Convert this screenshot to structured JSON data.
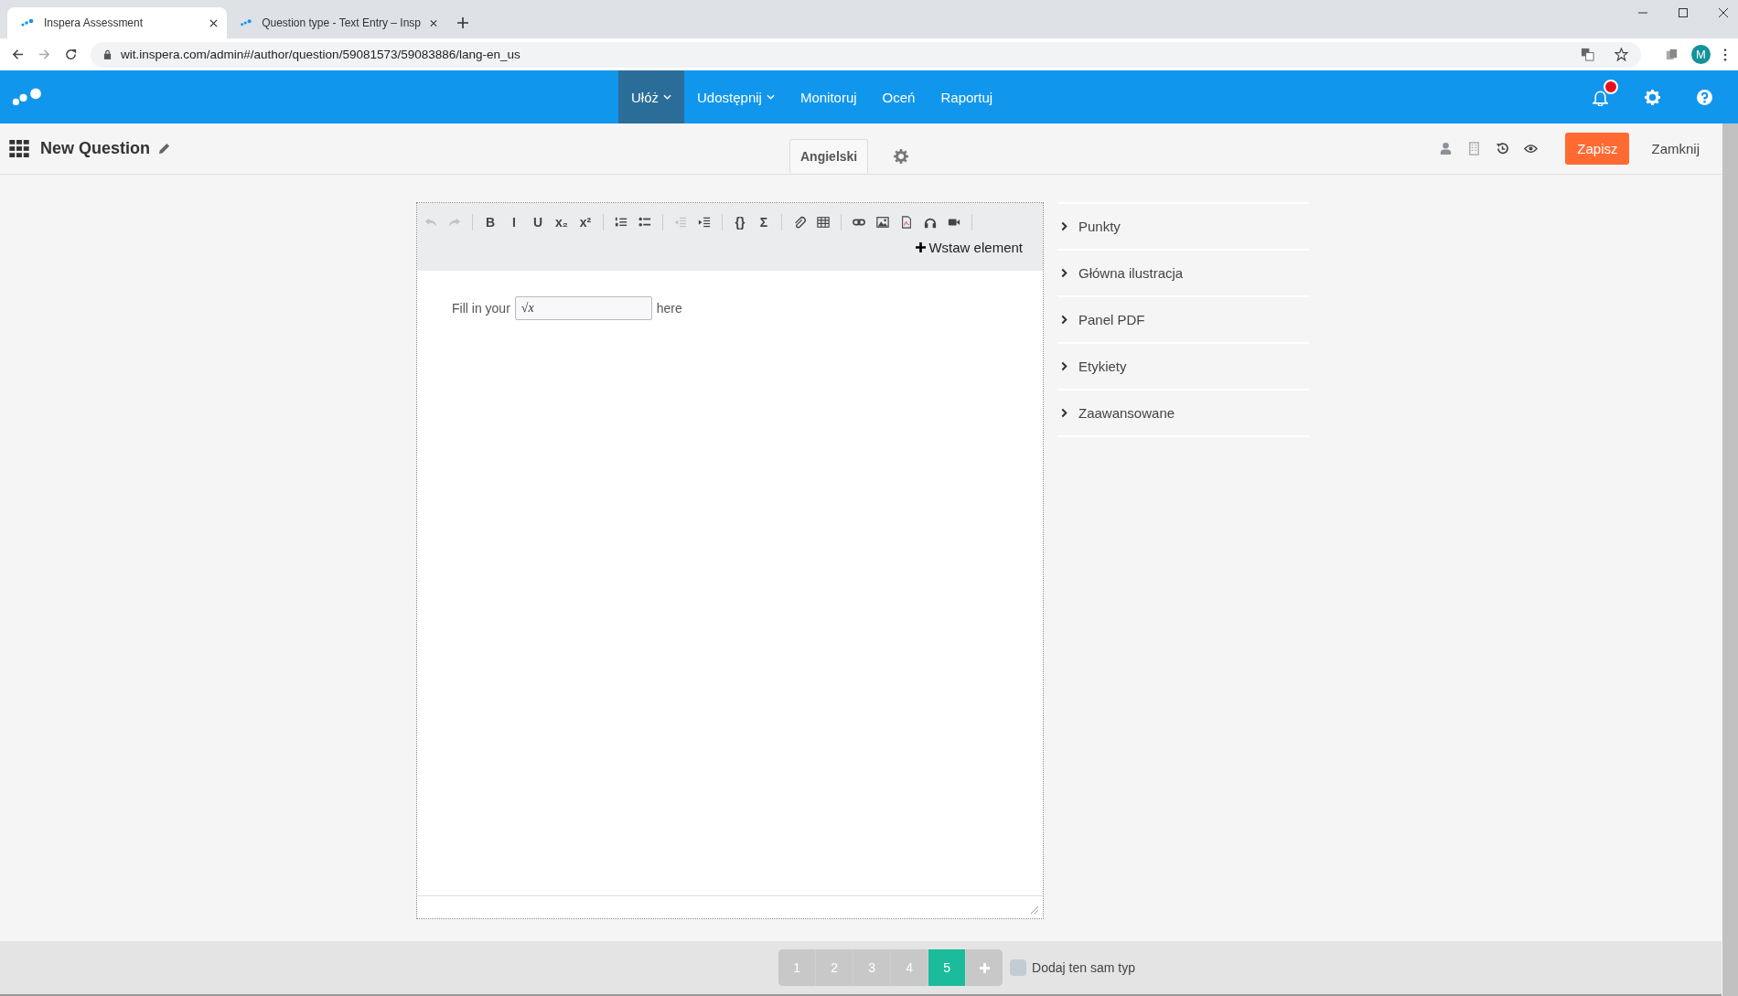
{
  "browser": {
    "tabs": [
      {
        "title": "Inspera Assessment",
        "selected": true
      },
      {
        "title": "Question type - Text Entry – Insp",
        "selected": false
      }
    ],
    "address": "wit.inspera.com/admin#/author/question/59081573/59083886/lang-en_us",
    "profile_initial": "M"
  },
  "nav": {
    "items": [
      {
        "label": "Ułóż",
        "dropdown": true,
        "selected": true
      },
      {
        "label": "Udostępnij",
        "dropdown": true,
        "selected": false
      },
      {
        "label": "Monitoruj",
        "dropdown": false,
        "selected": false
      },
      {
        "label": "Oceń",
        "dropdown": false,
        "selected": false
      },
      {
        "label": "Raportuj",
        "dropdown": false,
        "selected": false
      }
    ],
    "notification_badge": true
  },
  "question": {
    "title": "New Question",
    "language_tab": "Angielski",
    "save_button": "Zapisz",
    "close_link": "Zamknij"
  },
  "editor": {
    "toolbar_groups": [
      [
        {
          "kind": "undo",
          "disabled": true
        },
        {
          "kind": "redo",
          "disabled": true
        }
      ],
      [
        {
          "kind": "glyph",
          "text": "B",
          "disabled": false
        },
        {
          "kind": "glyph",
          "text": "I",
          "disabled": false
        },
        {
          "kind": "glyph",
          "text": "U",
          "disabled": false
        },
        {
          "kind": "glyph",
          "text": "x₂",
          "disabled": false
        },
        {
          "kind": "glyph",
          "text": "x²",
          "disabled": false
        }
      ],
      [
        {
          "kind": "ordered-list",
          "disabled": false
        },
        {
          "kind": "bullet-list",
          "disabled": false
        }
      ],
      [
        {
          "kind": "outdent",
          "disabled": true
        },
        {
          "kind": "indent",
          "disabled": false
        }
      ],
      [
        {
          "kind": "glyph",
          "text": "{}",
          "disabled": false
        },
        {
          "kind": "glyph",
          "text": "Σ",
          "disabled": false
        }
      ],
      [
        {
          "kind": "paperclip",
          "disabled": false
        },
        {
          "kind": "table",
          "disabled": false
        }
      ],
      [
        {
          "kind": "link",
          "disabled": false
        },
        {
          "kind": "image",
          "disabled": false
        },
        {
          "kind": "pdf",
          "disabled": false
        },
        {
          "kind": "headphones",
          "disabled": false
        },
        {
          "kind": "video",
          "disabled": false
        }
      ]
    ],
    "insert_button": "Wstaw element",
    "content": {
      "before": "Fill in your",
      "field_value": "√x",
      "after": "here"
    }
  },
  "sections": [
    {
      "label": "Punkty",
      "expanded": false
    },
    {
      "label": "Główna ilustracja",
      "expanded": false
    },
    {
      "label": "Panel PDF",
      "expanded": false
    },
    {
      "label": "Etykiety",
      "expanded": false
    },
    {
      "label": "Zaawansowane",
      "expanded": false
    }
  ],
  "pagination": {
    "pages": [
      {
        "label": "1",
        "selected": false
      },
      {
        "label": "2",
        "selected": false
      },
      {
        "label": "3",
        "selected": false
      },
      {
        "label": "4",
        "selected": false
      },
      {
        "label": "5",
        "selected": true
      }
    ],
    "same_type_checkbox": {
      "label": "Dodaj ten sam typ",
      "checked": false
    }
  }
}
